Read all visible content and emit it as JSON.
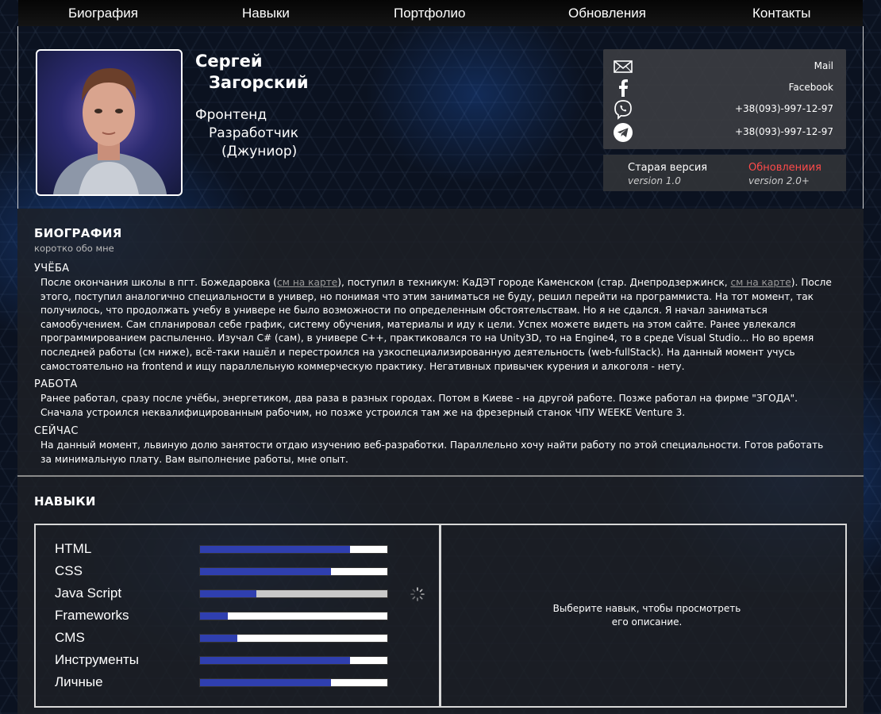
{
  "nav": {
    "items": [
      "Биография",
      "Навыки",
      "Портфолио",
      "Обновления",
      "Контакты"
    ]
  },
  "profile": {
    "name_first": "Сергей",
    "name_last": "Загорский",
    "role_1": "Фронтенд",
    "role_2": "Разработчик",
    "role_3": "(Джуниор)"
  },
  "contacts": [
    {
      "icon": "mail-icon",
      "text": "Mail"
    },
    {
      "icon": "facebook-icon",
      "text": "Facebook"
    },
    {
      "icon": "viber-icon",
      "text": "+38(093)-997-12-97"
    },
    {
      "icon": "telegram-icon",
      "text": "+38(093)-997-12-97"
    }
  ],
  "versions": {
    "old_label": "Старая версия",
    "old_version": "version 1.0",
    "new_label": "Обновлениия",
    "new_version": "version 2.0+",
    "new_color": "#ff4a4a"
  },
  "bio": {
    "title": "БИОГРАФИЯ",
    "subtitle": "коротко обо мне",
    "study_head": "УЧЁБА",
    "study_p1": "После окончания школы в пгт. Божедаровка (",
    "study_link1": "см на карте",
    "study_p2": "), поступил в техникум: КаДЭТ городе Каменском (стар. Днепродзержинск, ",
    "study_link2": "см на карте",
    "study_p3": "). После этого, поступил аналогично специальности в универ, но понимая что этим заниматься не буду, решил перейти на программиста. На тот момент, так получилось, что продолжать учебу в универе не было возможности по определенным обстоятельствам. Но я не сдался. Я начал заниматься самообучением. Сам спланировал себе график, систему обучения, материалы и иду к цели. Успех можете видеть на этом сайте. Ранее увлекался программированием распыленно. Изучал C# (сам), в универе C++, практиковался то на Unity3D, то на Engine4, то в среде Visual Studio... Но во время последней работы (см ниже), всё-таки нашёл и перестроился на узкоспециализированную деятельность (web-fullStack). На данный момент учусь самостоятельно на frontend и ищу параллельную коммерческую практику. Негативных привычек курения и алкоголя - нету.",
    "work_head": "РАБОТА",
    "work_text": "Ранее работал, сразу после учёбы, энергетиком, два раза в разных городах. Потом в Киеве - на другой работе. Позже работал на фирме \"ЗГОДА\". Сначала устроился неквалифицированным рабочим, но позже устроился там же на фрезерный станок ЧПУ WEEKE Venture 3.",
    "now_head": "СЕЙЧАС",
    "now_text": "На данный момент, львиную долю занятости отдаю изучению веб-разработки. Параллельно хочу найти работу по этой специальности. Готов работать за минимальную плату. Вам выполнение работы, мне опыт."
  },
  "skills": {
    "title": "НАВЫКИ",
    "hint": "Выберите навык, чтобы просмотреть его описание.",
    "items": [
      {
        "name": "HTML",
        "level": 0.8,
        "loading": false
      },
      {
        "name": "CSS",
        "level": 0.7,
        "loading": false
      },
      {
        "name": "Java Script",
        "level": 0.3,
        "loading": true
      },
      {
        "name": "Frameworks",
        "level": 0.15,
        "loading": false
      },
      {
        "name": "CMS",
        "level": 0.2,
        "loading": false
      },
      {
        "name": "Инструменты",
        "level": 0.8,
        "loading": false
      },
      {
        "name": "Личные",
        "level": 0.7,
        "loading": false
      }
    ]
  }
}
